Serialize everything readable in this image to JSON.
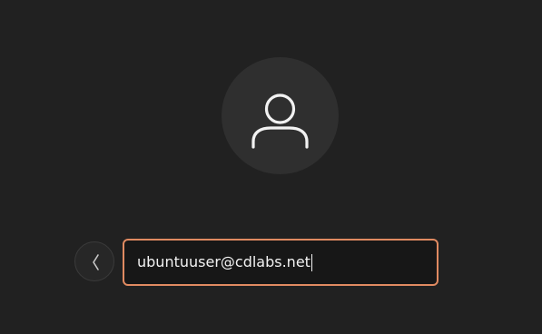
{
  "login": {
    "username_value": "ubuntuuser@cdlabs.net",
    "avatar_icon": "user-icon",
    "back_icon": "chevron-left-icon"
  },
  "colors": {
    "background": "#212121",
    "avatar_background": "#2f2f2f",
    "field_border": "#e08a61",
    "field_background": "#171717",
    "text": "#f2f2f2"
  }
}
